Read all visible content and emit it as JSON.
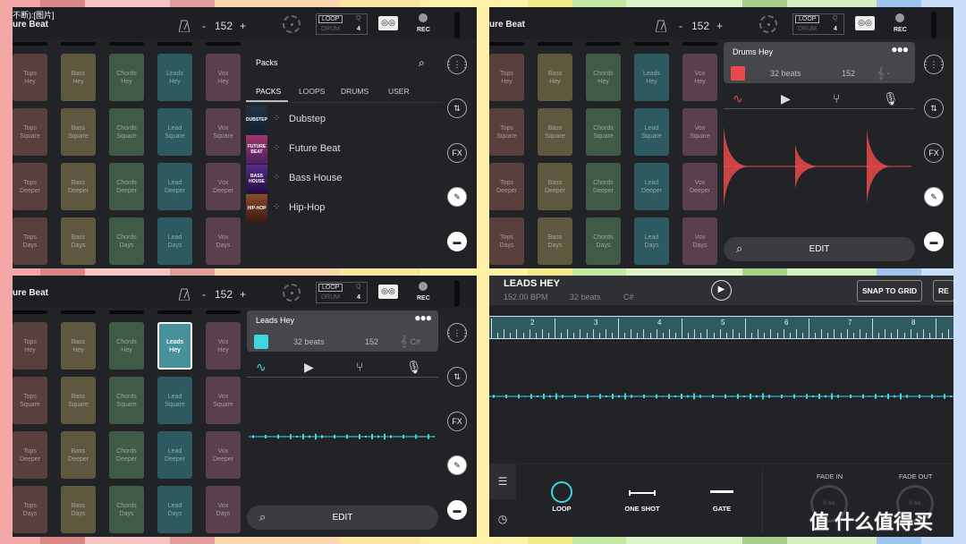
{
  "status_bar": "不断):[图片]",
  "topbar": {
    "project_title": "ure Beat",
    "bpm": "152",
    "minus": "-",
    "plus": "+",
    "loop_label": "LOOP",
    "drum_label": "DRUM",
    "q_label": "Q",
    "q_value": "4",
    "rec_label": "REC"
  },
  "pads": [
    [
      "Tops\nHey",
      "Tops\nSquare",
      "Tops\nDeeper",
      "Tops\nDays"
    ],
    [
      "Bass\nHey",
      "Bass\nSquare",
      "Bass\nDeeper",
      "Bass\nDays"
    ],
    [
      "Chords\nHey",
      "Chords\nSquare",
      "Chords\nDeeper",
      "Chords\nDays"
    ],
    [
      "Leads\nHey",
      "Lead\nSquare",
      "Lead\nDeeper",
      "Lead\nDays"
    ],
    [
      "Vox\nHey",
      "Vox\nSquare",
      "Vox\nDeeper",
      "Vox\nDays"
    ]
  ],
  "pad_colors": [
    "#5a403d",
    "#5e583e",
    "#3f5a45",
    "#2d5a60",
    "#5a3f4c"
  ],
  "sidebar": {
    "icons": [
      "grid-icon",
      "mixer-icon",
      "fx-icon",
      "edit-icon",
      "folder-icon"
    ],
    "fx_label": "FX"
  },
  "browser": {
    "title": "Packs",
    "tabs": [
      "PACKS",
      "LOOPS",
      "DRUMS",
      "USER"
    ],
    "active_tab": "PACKS",
    "items": [
      {
        "name": "Dubstep",
        "thumb": "DUBSTEP"
      },
      {
        "name": "Future Beat",
        "thumb": "FUTURE BEAT"
      },
      {
        "name": "Bass House",
        "thumb": "BASS HOUSE"
      },
      {
        "name": "Hip-Hop",
        "thumb": "HIP-HOP"
      }
    ]
  },
  "drum_card": {
    "name": "Drums Hey",
    "beats": "32 beats",
    "bpm": "152",
    "key": "-",
    "color": "#e84a4a"
  },
  "leads_card": {
    "name": "Leads Hey",
    "beats": "32 beats",
    "bpm": "152",
    "key": "C#",
    "color": "#3fd6e0"
  },
  "edit_label": "EDIT",
  "selected_pad": "Leads Hey",
  "editor": {
    "title": "LEADS HEY",
    "bpm": "152.00 BPM",
    "beats": "32 beats",
    "key": "C#",
    "snap_button": "SNAP TO GRID",
    "cut_button": "RE",
    "ruler_labels": [
      "2",
      "3",
      "4",
      "5",
      "6",
      "7",
      "8"
    ],
    "modes": [
      "LOOP",
      "ONE SHOT",
      "GATE"
    ],
    "active_mode": "LOOP",
    "fade_in_label": "FADE IN",
    "fade_out_label": "FADE OUT",
    "fade_in_value": "0 ms",
    "fade_out_value": "0 ms",
    "accent": "#3fd6e0"
  },
  "watermark": "值 什么值得买"
}
